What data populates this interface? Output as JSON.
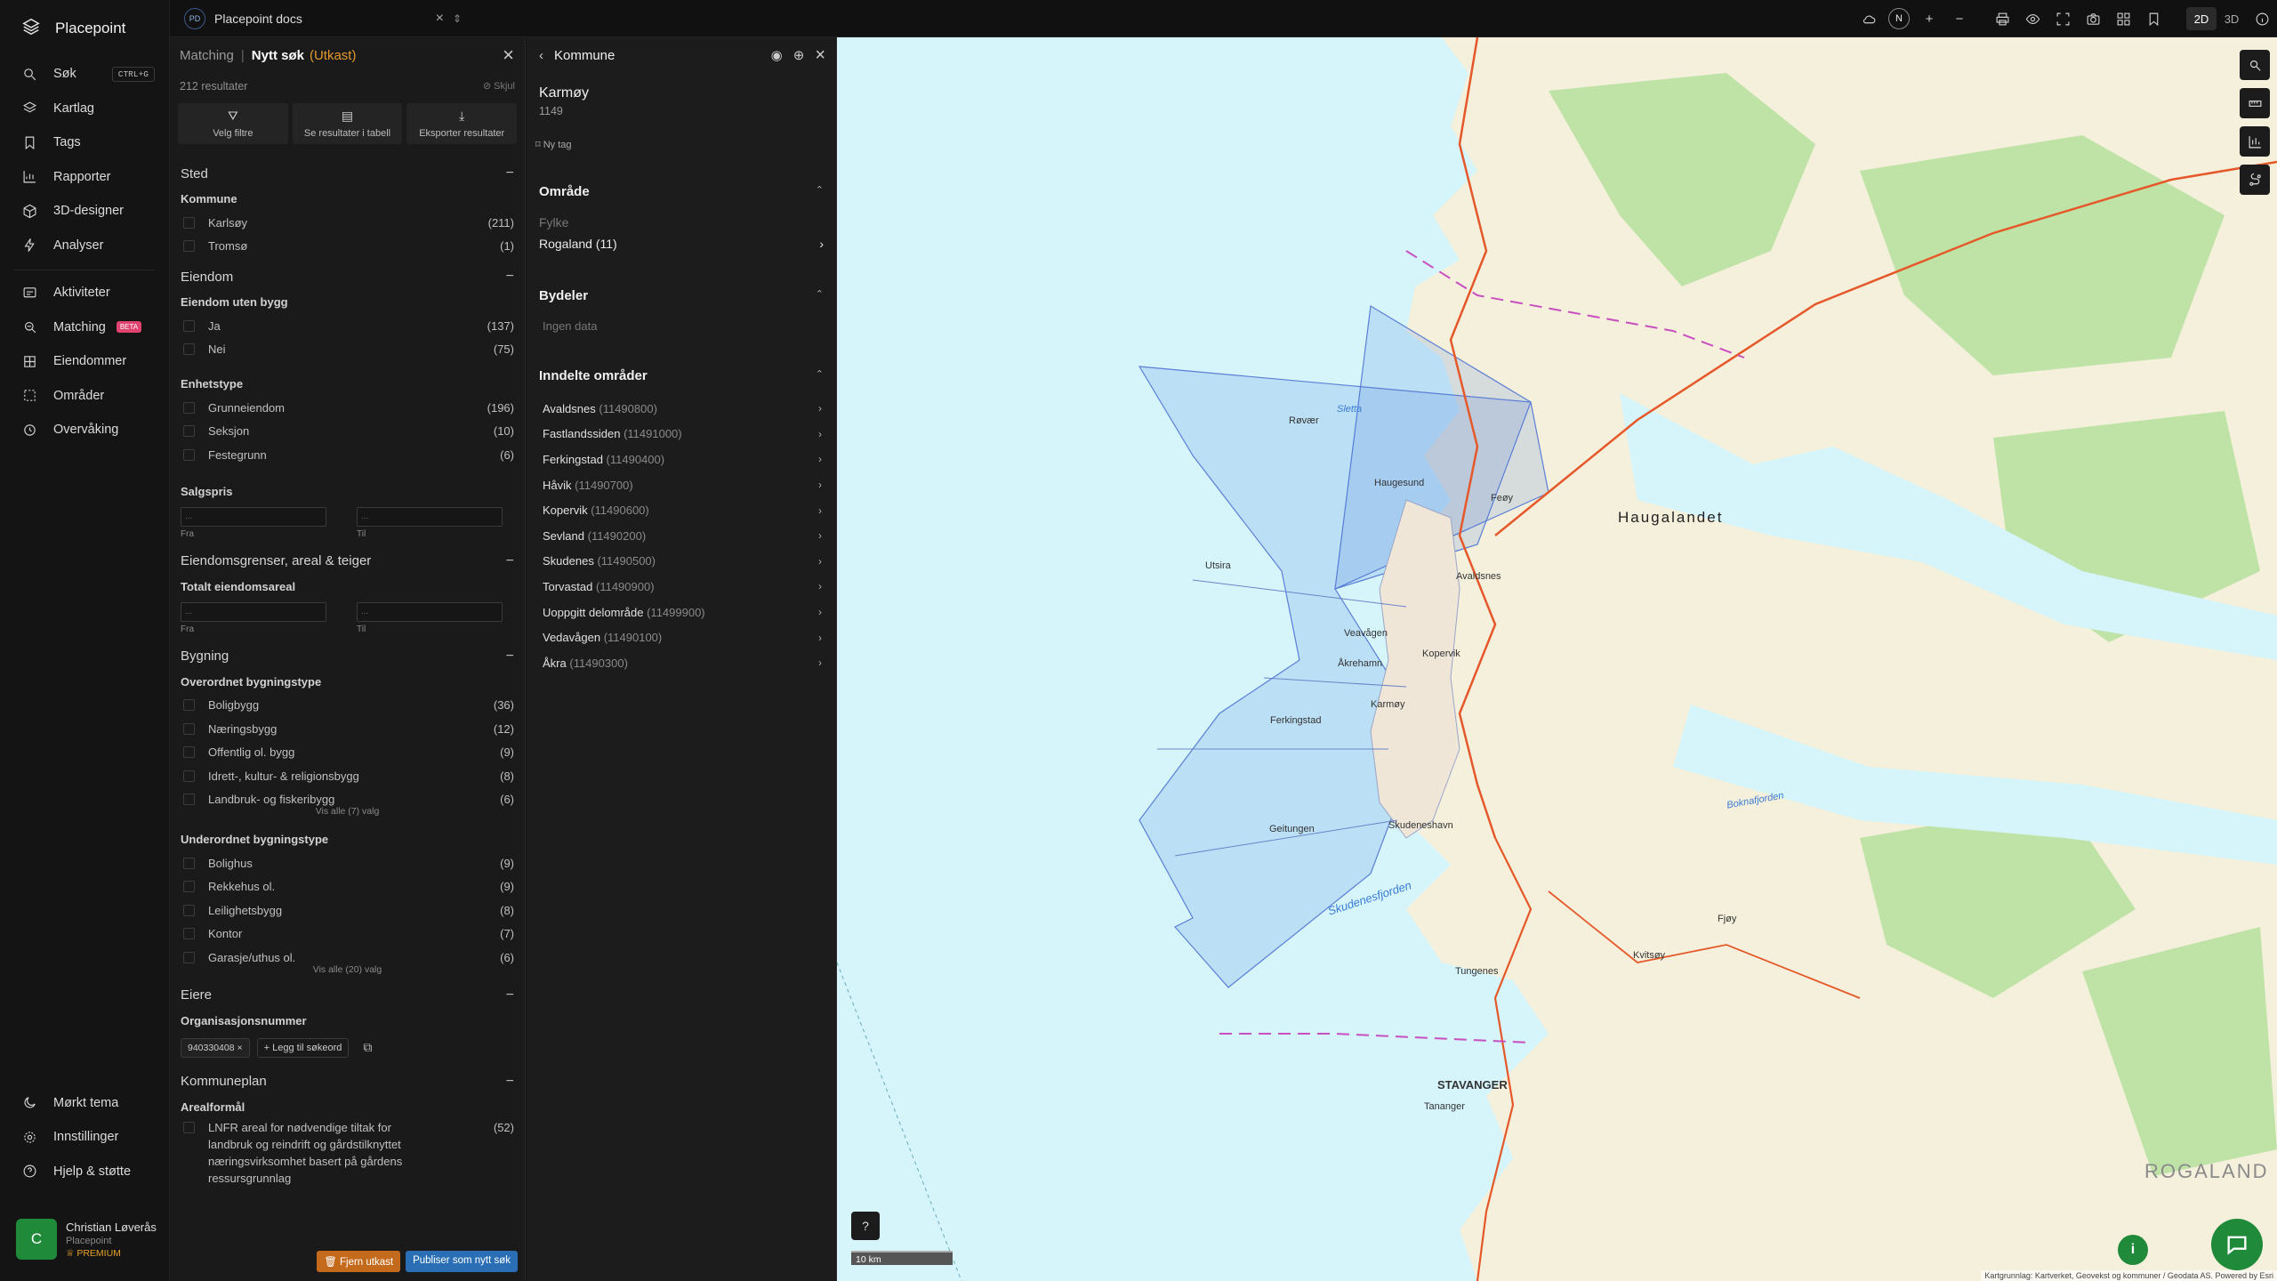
{
  "app": {
    "name": "Placepoint"
  },
  "sidebar": {
    "items": [
      {
        "label": "Søk",
        "icon": "search-icon",
        "shortcut": "CTRL+G"
      },
      {
        "label": "Kartlag",
        "icon": "layers-icon"
      },
      {
        "label": "Tags",
        "icon": "bookmark-icon"
      },
      {
        "label": "Rapporter",
        "icon": "chart-icon"
      },
      {
        "label": "3D-designer",
        "icon": "cube-icon"
      },
      {
        "label": "Analyser",
        "icon": "bolt-icon"
      },
      {
        "label": "Aktiviteter",
        "icon": "activity-icon"
      },
      {
        "label": "Matching",
        "icon": "matching-icon",
        "badge": "BETA"
      },
      {
        "label": "Eiendommer",
        "icon": "grid-icon"
      },
      {
        "label": "Områder",
        "icon": "area-icon"
      },
      {
        "label": "Overvåking",
        "icon": "monitor-icon"
      }
    ],
    "bottom": [
      {
        "label": "Mørkt tema",
        "icon": "moon-icon"
      },
      {
        "label": "Innstillinger",
        "icon": "gear-icon"
      },
      {
        "label": "Hjelp & støtte",
        "icon": "help-icon"
      }
    ],
    "user": {
      "initial": "C",
      "name": "Christian Løverås",
      "org": "Placepoint",
      "plan": "PREMIUM"
    }
  },
  "topbar": {
    "workspace_badge": "PD",
    "workspace": "Placepoint docs",
    "compass": "N",
    "modes": [
      "2D",
      "3D"
    ],
    "active_mode": "2D"
  },
  "search": {
    "crumb": "Matching",
    "title": "Nytt søk",
    "status": "(Utkast)",
    "results": "212 resultater",
    "hide_label": "Skjul",
    "actions": [
      "Velg filtre",
      "Se resultater i tabell",
      "Eksporter resultater"
    ],
    "sections": {
      "sted": {
        "title": "Sted",
        "kommune_label": "Kommune",
        "kommune": [
          {
            "label": "Karlsøy",
            "count": "(211)"
          },
          {
            "label": "Tromsø",
            "count": "(1)"
          }
        ]
      },
      "eiendom": {
        "title": "Eiendom",
        "uten_bygg_label": "Eiendom uten bygg",
        "uten_bygg": [
          {
            "label": "Ja",
            "count": "(137)"
          },
          {
            "label": "Nei",
            "count": "(75)"
          }
        ],
        "enhetstype_label": "Enhetstype",
        "enhetstype": [
          {
            "label": "Grunneiendom",
            "count": "(196)"
          },
          {
            "label": "Seksjon",
            "count": "(10)"
          },
          {
            "label": "Festegrunn",
            "count": "(6)"
          }
        ],
        "salgspris_label": "Salgspris",
        "from": "Fra",
        "to": "Til",
        "from_placeholder": "...",
        "to_placeholder": "..."
      },
      "grenser": {
        "title": "Eiendomsgrenser, areal & teiger",
        "areal_label": "Totalt eiendomsareal",
        "from": "Fra",
        "to": "Til",
        "from_placeholder": "...",
        "to_placeholder": "..."
      },
      "bygning": {
        "title": "Bygning",
        "overordnet_label": "Overordnet bygningstype",
        "overordnet": [
          {
            "label": "Boligbygg",
            "count": "(36)"
          },
          {
            "label": "Næringsbygg",
            "count": "(12)"
          },
          {
            "label": "Offentlig ol. bygg",
            "count": "(9)"
          },
          {
            "label": "Idrett-, kultur- & religionsbygg",
            "count": "(8)"
          },
          {
            "label": "Landbruk- og fiskeribygg",
            "count": "(6)"
          }
        ],
        "overordnet_more": "Vis alle (7) valg",
        "underordnet_label": "Underordnet bygningstype",
        "underordnet": [
          {
            "label": "Bolighus",
            "count": "(9)"
          },
          {
            "label": "Rekkehus ol.",
            "count": "(9)"
          },
          {
            "label": "Leilighetsbygg",
            "count": "(8)"
          },
          {
            "label": "Kontor",
            "count": "(7)"
          },
          {
            "label": "Garasje/uthus ol.",
            "count": "(6)"
          }
        ],
        "underordnet_more": "Vis alle (20) valg"
      },
      "eiere": {
        "title": "Eiere",
        "orgnr_label": "Organisasjonsnummer",
        "chip": "940330408",
        "add": "Legg til søkeord"
      },
      "kommuneplan": {
        "title": "Kommuneplan",
        "arealformal_label": "Arealformål",
        "arealformal": [
          {
            "label": "LNFR areal for nødvendige tiltak for landbruk og reindrift og gårdstilknyttet næringsvirksomhet basert på gårdens ressursgrunnlag",
            "count": "(52)"
          }
        ]
      }
    },
    "footer": {
      "remove": "Fjern utkast",
      "publish": "Publiser som nytt søk"
    }
  },
  "kommune": {
    "header": "Kommune",
    "name": "Karmøy",
    "code": "1149",
    "tag": "Ny tag",
    "omrade": {
      "title": "Område",
      "fylke_label": "Fylke",
      "fylke": "Rogaland (11)"
    },
    "bydeler": {
      "title": "Bydeler",
      "empty": "Ingen data"
    },
    "inndelte": {
      "title": "Inndelte områder",
      "items": [
        {
          "name": "Avaldsnes",
          "code": "(11490800)"
        },
        {
          "name": "Fastlandssiden",
          "code": "(11491000)"
        },
        {
          "name": "Ferkingstad",
          "code": "(11490400)"
        },
        {
          "name": "Håvik",
          "code": "(11490700)"
        },
        {
          "name": "Kopervik",
          "code": "(11490600)"
        },
        {
          "name": "Sevland",
          "code": "(11490200)"
        },
        {
          "name": "Skudenes",
          "code": "(11490500)"
        },
        {
          "name": "Torvastad",
          "code": "(11490900)"
        },
        {
          "name": "Uoppgitt delområde",
          "code": "(11499900)"
        },
        {
          "name": "Vedavågen",
          "code": "(11490100)"
        },
        {
          "name": "Åkra",
          "code": "(11490300)"
        }
      ]
    }
  },
  "map": {
    "scale": "10 km",
    "attribution": "Kartgrunnlag: Kartverket, Geovekst og kommuner / Geodata AS. Powered by Esri",
    "labels": {
      "haugalandet": "Haugalandet",
      "stavanger": "STAVANGER",
      "rogaland": "ROGALAND",
      "haugesund": "Haugesund",
      "kopervik": "Kopervik",
      "akrehamn": "Åkrehamn",
      "skudeneshavn": "Skudeneshavn",
      "karmoy": "Karmøy",
      "utsira": "Utsira",
      "sletta": "Sletta",
      "skudenesfjorden": "Skudenesfjorden",
      "boknafjorden": "Boknafjorden",
      "vedavagen": "Veavågen",
      "ferkingstad": "Ferkingstad",
      "avaldsnes": "Avaldsnes",
      "rovaer": "Røvær",
      "feoy": "Feøy",
      "tungenes": "Tungenes",
      "kvitsoy": "Kvitsøy",
      "fjoy": "Fjøy",
      "tananger": "Tananger",
      "geitungen": "Geitungen"
    },
    "colors": {
      "sea": "#d5f5fb",
      "land": "#f5f0dc",
      "forest": "#bfe3a6",
      "kommune_fill": "#3a6fd8",
      "road": "#e5582a"
    }
  }
}
